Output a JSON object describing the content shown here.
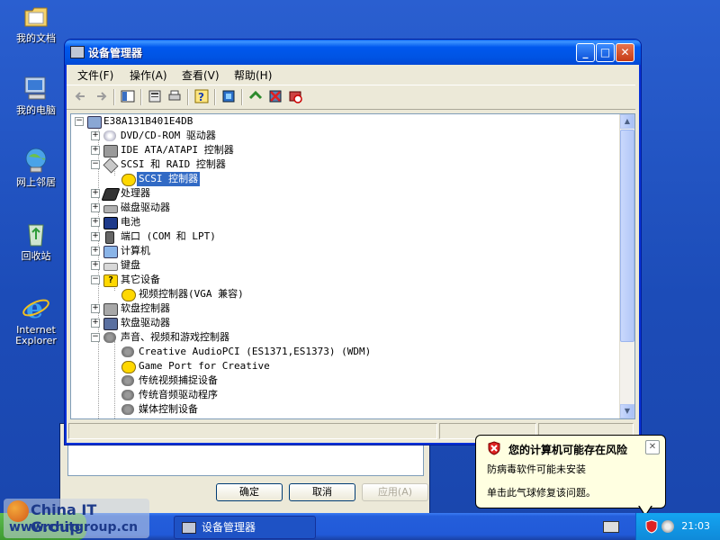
{
  "desktop": {
    "icons": [
      {
        "label": "我的文档",
        "icon": "my-documents-icon"
      },
      {
        "label": "我的电脑",
        "icon": "my-computer-icon"
      },
      {
        "label": "网上邻居",
        "icon": "network-places-icon"
      },
      {
        "label": "回收站",
        "icon": "recycle-bin-icon"
      },
      {
        "label": "Internet Explorer",
        "icon": "ie-icon"
      }
    ]
  },
  "window": {
    "title": "设备管理器",
    "menu": [
      "文件(F)",
      "操作(A)",
      "查看(V)",
      "帮助(H)"
    ],
    "controls": {
      "minimize": "_",
      "maximize": "□",
      "close": "✕"
    }
  },
  "tree": {
    "root": "E38A131B401E4DB",
    "items": [
      {
        "label": "DVD/CD-ROM 驱动器",
        "expanded": false,
        "level": 1
      },
      {
        "label": "IDE ATA/ATAPI 控制器",
        "expanded": false,
        "level": 1
      },
      {
        "label": "SCSI 和 RAID 控制器",
        "expanded": true,
        "level": 1
      },
      {
        "label": "SCSI 控制器",
        "level": 2,
        "selected": true,
        "warning": true
      },
      {
        "label": "处理器",
        "expanded": false,
        "level": 1
      },
      {
        "label": "磁盘驱动器",
        "expanded": false,
        "level": 1
      },
      {
        "label": "电池",
        "expanded": false,
        "level": 1
      },
      {
        "label": "端口 (COM 和 LPT)",
        "expanded": false,
        "level": 1
      },
      {
        "label": "计算机",
        "expanded": false,
        "level": 1
      },
      {
        "label": "键盘",
        "expanded": false,
        "level": 1
      },
      {
        "label": "其它设备",
        "expanded": true,
        "level": 1
      },
      {
        "label": "视频控制器(VGA 兼容)",
        "level": 2,
        "warning": true
      },
      {
        "label": "软盘控制器",
        "expanded": false,
        "level": 1
      },
      {
        "label": "软盘驱动器",
        "expanded": false,
        "level": 1
      },
      {
        "label": "声音、视频和游戏控制器",
        "expanded": true,
        "level": 1
      },
      {
        "label": "Creative AudioPCI (ES1371,ES1373) (WDM)",
        "level": 2
      },
      {
        "label": "Game Port for Creative",
        "level": 2,
        "warning": true
      },
      {
        "label": "传统视频捕捉设备",
        "level": 2
      },
      {
        "label": "传统音频驱动程序",
        "level": 2
      },
      {
        "label": "媒体控制设备",
        "level": 2
      }
    ]
  },
  "back_dialog": {
    "ok": "确定",
    "cancel": "取消",
    "apply": "应用(A)"
  },
  "balloon": {
    "title": "您的计算机可能存在风险",
    "line1": "防病毒软件可能未安装",
    "line2": "单击此气球修复该问题。"
  },
  "taskbar": {
    "task_label": "设备管理器",
    "clock": "21:03"
  },
  "watermark": {
    "line1": "China IT Group",
    "line2": "www.chitgroup.cn"
  }
}
